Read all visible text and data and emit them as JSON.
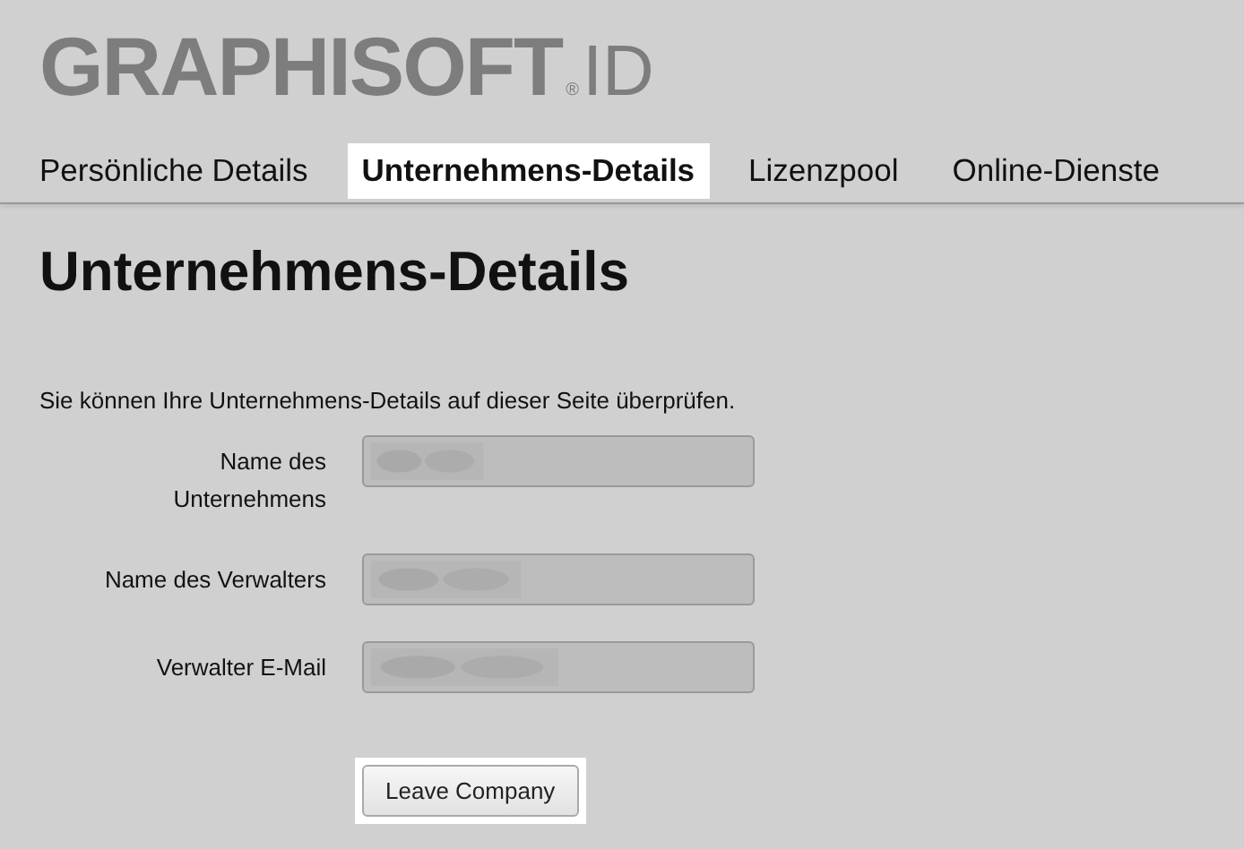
{
  "logo": {
    "name": "GRAPHISOFT",
    "mark": "®",
    "suffix": "ID"
  },
  "tabs": [
    {
      "label": "Persönliche Details",
      "selected": false
    },
    {
      "label": "Unternehmens-Details",
      "selected": true
    },
    {
      "label": "Lizenzpool",
      "selected": false
    },
    {
      "label": "Online-Dienste",
      "selected": false
    }
  ],
  "heading": "Unternehmens-Details",
  "intro": "Sie können Ihre Unternehmens-Details auf dieser Seite überprüfen.",
  "fields": [
    {
      "label": "Name des Unternehmens",
      "redacted": true
    },
    {
      "label": "Name des Verwalters",
      "redacted": true
    },
    {
      "label": "Verwalter E-Mail",
      "redacted": true
    }
  ],
  "button": {
    "label": "Leave Company",
    "highlighted": true
  }
}
